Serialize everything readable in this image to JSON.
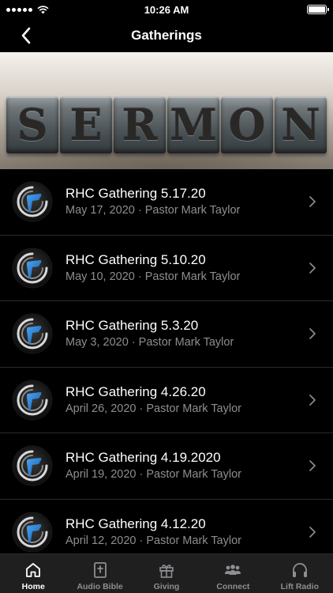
{
  "status_bar": {
    "time": "10:26 AM"
  },
  "nav": {
    "title": "Gatherings"
  },
  "banner": {
    "letters": [
      "S",
      "E",
      "R",
      "M",
      "O",
      "N"
    ]
  },
  "gatherings": [
    {
      "title": "RHC Gathering 5.17.20",
      "subtitle": "May 17, 2020 · Pastor Mark Taylor"
    },
    {
      "title": "RHC Gathering 5.10.20",
      "subtitle": "May 10, 2020 · Pastor Mark Taylor"
    },
    {
      "title": "RHC Gathering 5.3.20",
      "subtitle": "May 3, 2020 · Pastor Mark Taylor"
    },
    {
      "title": "RHC Gathering 4.26.20",
      "subtitle": "April 26, 2020 · Pastor Mark Taylor"
    },
    {
      "title": "RHC Gathering 4.19.2020",
      "subtitle": "April 19, 2020 · Pastor Mark Taylor"
    },
    {
      "title": "RHC Gathering 4.12.20",
      "subtitle": "April 12, 2020 · Pastor Mark Taylor"
    }
  ],
  "tabs": [
    {
      "label": "Home",
      "icon": "home-icon",
      "active": true
    },
    {
      "label": "Audio Bible",
      "icon": "bible-icon",
      "active": false
    },
    {
      "label": "Giving",
      "icon": "gift-icon",
      "active": false
    },
    {
      "label": "Connect",
      "icon": "people-icon",
      "active": false
    },
    {
      "label": "Lift Radio",
      "icon": "headphones-icon",
      "active": false
    }
  ],
  "colors": {
    "background": "#000000",
    "tab_bar": "#1f1f1f",
    "subtitle": "#8e8e93",
    "accent_blue": "#1a73c9"
  }
}
